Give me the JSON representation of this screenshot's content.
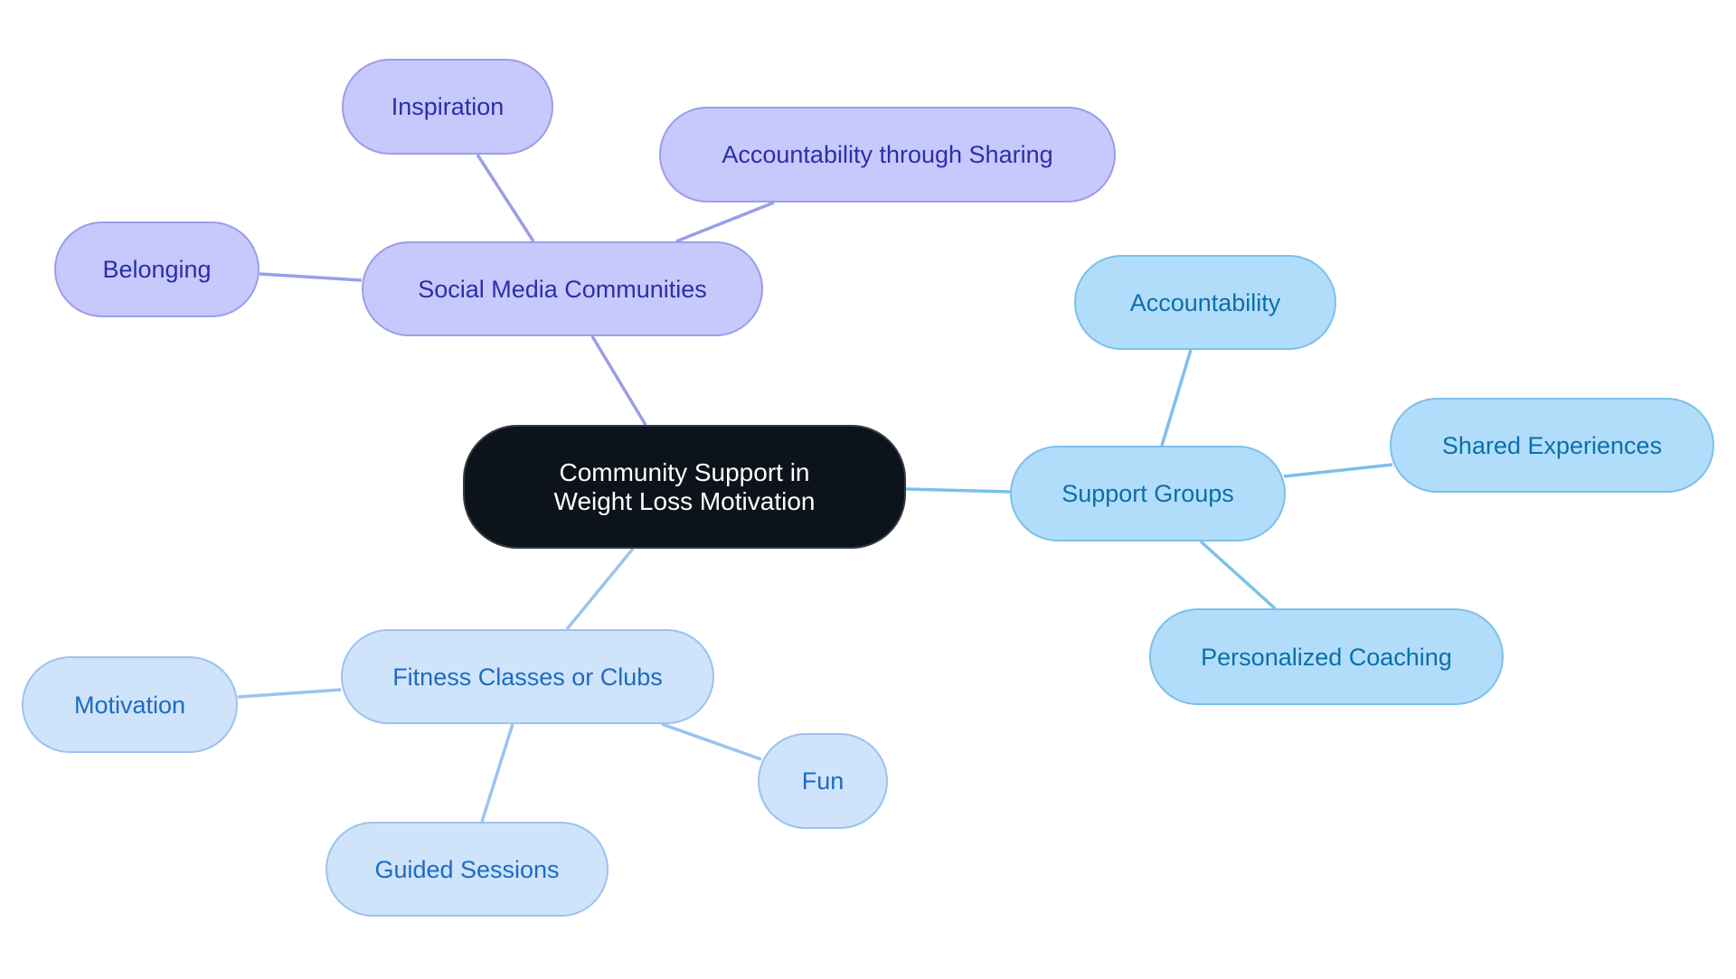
{
  "colors": {
    "root_fill": "#0d131a",
    "social_branch": "#c7c9fc",
    "social_text": "#2a2fa8",
    "social_edge": "#9a9ee8",
    "support_branch": "#b1ddfb",
    "support_text": "#0b6fa8",
    "support_edge": "#7cc0ea",
    "fitness_branch": "#cfe3fb",
    "fitness_text": "#1c6cc0",
    "fitness_edge": "#9cc3ee"
  },
  "root": {
    "label": "Community Support in Weight Loss Motivation"
  },
  "branches": {
    "social": {
      "label": "Social Media Communities",
      "children": [
        "Inspiration",
        "Accountability through Sharing",
        "Belonging"
      ]
    },
    "support": {
      "label": "Support Groups",
      "children": [
        "Accountability",
        "Shared Experiences",
        "Personalized Coaching"
      ]
    },
    "fitness": {
      "label": "Fitness Classes or Clubs",
      "children": [
        "Motivation",
        "Fun",
        "Guided Sessions"
      ]
    }
  }
}
